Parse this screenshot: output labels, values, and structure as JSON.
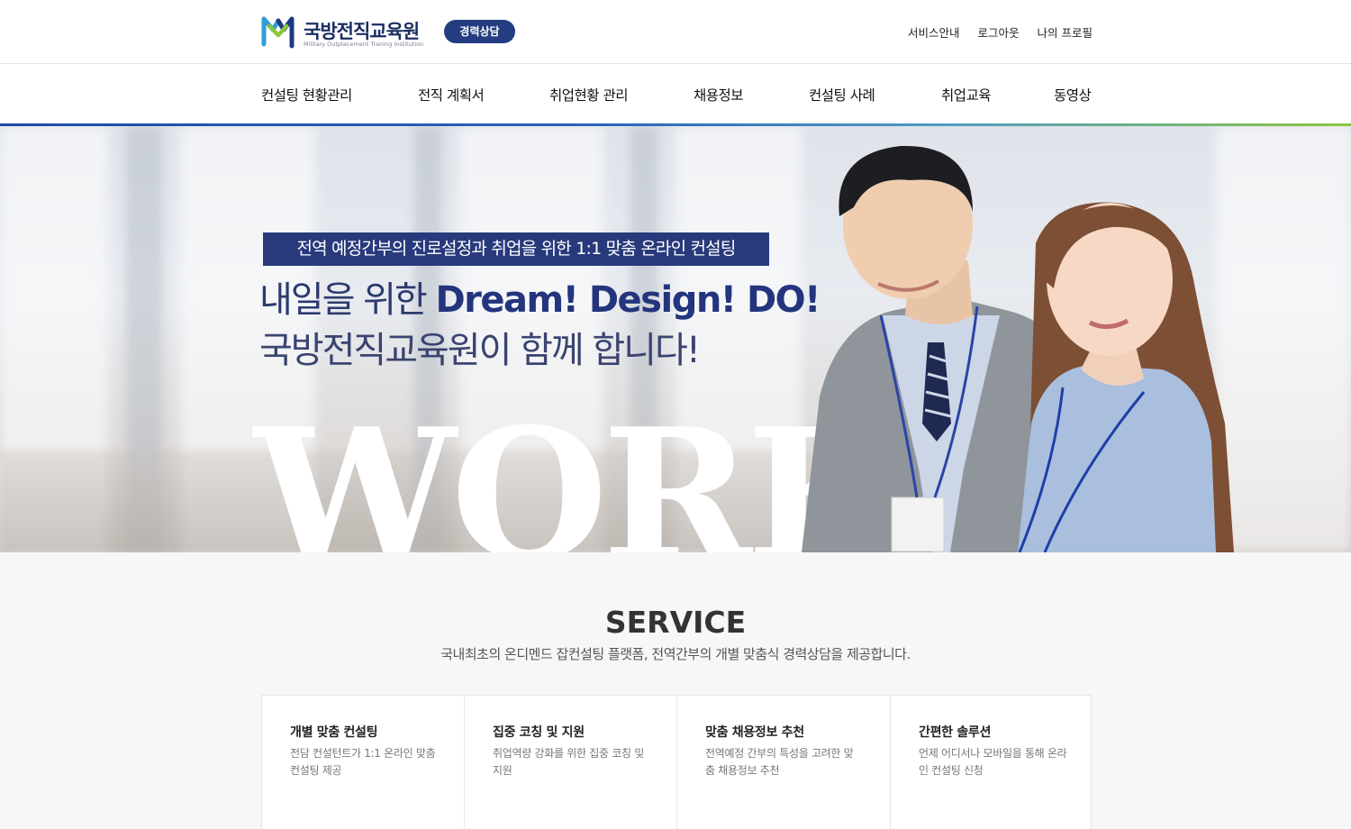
{
  "header": {
    "logo_title": "국방전직교육원",
    "logo_subtitle": "Military Outplacement Traning Institution",
    "badge": "경력상담",
    "util_links": [
      "서비스안내",
      "로그아웃",
      "나의 프로필"
    ]
  },
  "nav": {
    "items": [
      "컨설팅 현황관리",
      "전직 계획서",
      "취업현황 관리",
      "채용정보",
      "컨설팅 사례",
      "취업교육",
      "동영상"
    ]
  },
  "hero": {
    "tagline": "전역 예정간부의 진로설정과 취업을 위한 1:1 맞춤 온라인 컨설팅",
    "headline_prefix": "내일을 위한",
    "headline_emphasis": "Dream! Design! DO!",
    "headline_line2": "국방전직교육원이 함께 합니다!",
    "background_word": "WORK"
  },
  "service": {
    "title": "SERVICE",
    "description": "국내최초의 온디멘드 잡컨설팅 플랫폼, 전역간부의 개별 맞춤식 경력상담을 제공합니다.",
    "cards": [
      {
        "title": "개별 맞춤 컨설팅",
        "text": "전담 컨설턴트가 1:1 온라인 맞춤 컨설팅 제공"
      },
      {
        "title": "집중 코칭 및 지원",
        "text": "취업역량 강화를 위한 집중 코칭 및 지원"
      },
      {
        "title": "맞춤 채용정보 추천",
        "text": "전역예정 간부의 특성을 고려한 맞춤 채용정보 추천"
      },
      {
        "title": "간편한 솔루션",
        "text": "언제 어디서나 모바일을 통해 온라인 컨설팅 신청"
      }
    ]
  },
  "colors": {
    "brand_navy": "#233d80",
    "gradient_start": "#1f4aa8",
    "gradient_end": "#8cc63f"
  }
}
